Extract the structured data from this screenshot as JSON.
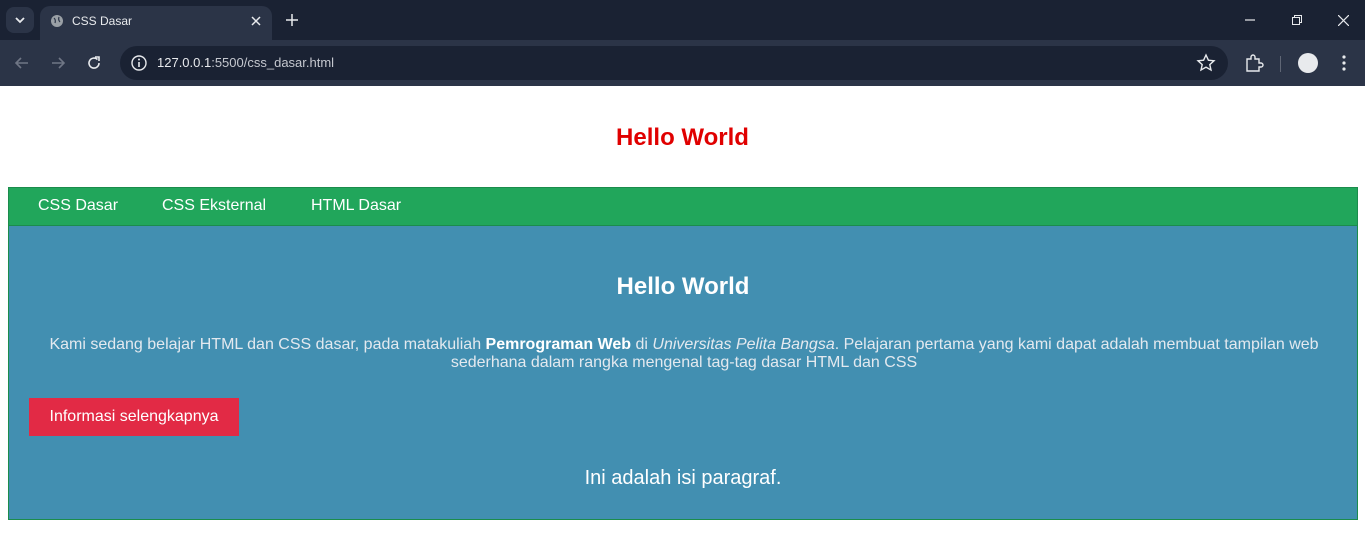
{
  "browser": {
    "tab_title": "CSS Dasar",
    "url_host": "127.0.0.1",
    "url_rest": ":5500/css_dasar.html",
    "colors": {
      "tabbar": "#1a2233",
      "toolbar": "#2b3447"
    }
  },
  "page": {
    "heading": "Hello World",
    "nav": [
      "CSS Dasar",
      "CSS Eksternal",
      "HTML Dasar"
    ],
    "content": {
      "title": "Hello World",
      "intro_part1": "Kami sedang belajar HTML dan CSS dasar, pada matakuliah ",
      "intro_bold": "Pemrograman Web",
      "intro_part2": " di ",
      "intro_italic": "Universitas Pelita Bangsa",
      "intro_part3": ". Pelajaran pertama yang kami dapat adalah membuat tampilan web sederhana dalam rangka mengenal tag-tag dasar HTML dan CSS",
      "button_label": "Informasi selengkapnya",
      "paragraph": "Ini adalah isi paragraf."
    },
    "colors": {
      "heading": "#e00000",
      "navbar": "#21a65b",
      "content_bg": "#428fb1",
      "button": "#e22a45"
    }
  }
}
